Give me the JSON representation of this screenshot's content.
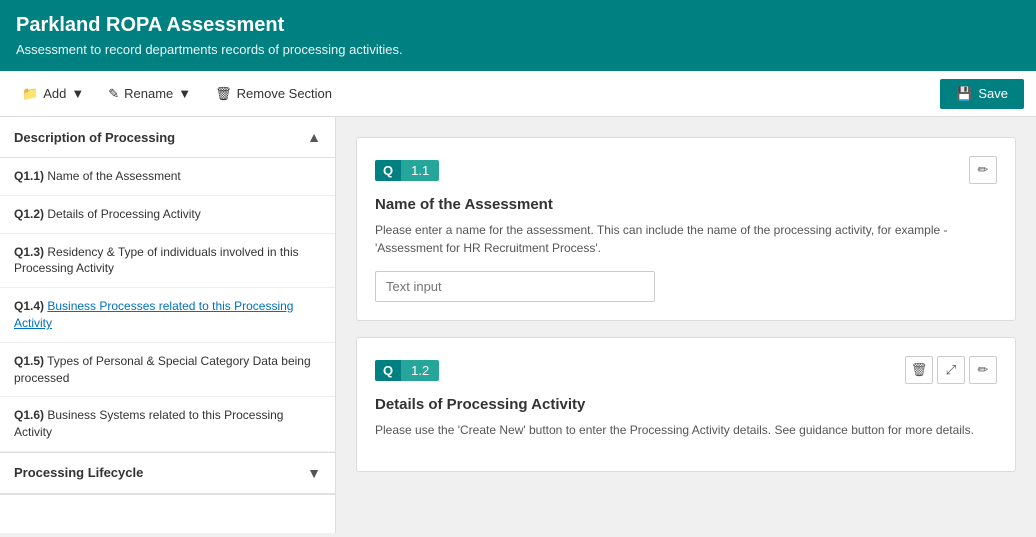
{
  "header": {
    "title": "Parkland ROPA Assessment",
    "subtitle": "Assessment to record departments records of processing activities."
  },
  "toolbar": {
    "add_label": "Add",
    "rename_label": "Rename",
    "remove_section_label": "Remove Section",
    "save_label": "Save"
  },
  "sidebar": {
    "sections": [
      {
        "id": "description",
        "title": "Description of Processing",
        "expanded": true,
        "items": [
          {
            "id": "q1_1",
            "number": "Q1.1)",
            "text": "Name of the Assessment",
            "link": false
          },
          {
            "id": "q1_2",
            "number": "Q1.2)",
            "text": "Details of Processing Activity",
            "link": false
          },
          {
            "id": "q1_3",
            "number": "Q1.3)",
            "text": "Residency & Type of individuals involved in this Processing Activity",
            "link": false
          },
          {
            "id": "q1_4",
            "number": "Q1.4)",
            "text": "Business Processes related to this Processing Activity",
            "link": true
          },
          {
            "id": "q1_5",
            "number": "Q1.5)",
            "text": "Types of Personal & Special Category Data being processed",
            "link": false
          },
          {
            "id": "q1_6",
            "number": "Q1.6)",
            "text": "Business Systems related to this Processing Activity",
            "link": false
          }
        ]
      },
      {
        "id": "lifecycle",
        "title": "Processing Lifecycle",
        "expanded": false,
        "items": []
      }
    ]
  },
  "questions": [
    {
      "id": "q1_1",
      "q_label": "Q",
      "q_number": "1.1",
      "title": "Name of the Assessment",
      "description": "Please enter a name for the assessment. This can include the name of the processing activity, for example - 'Assessment for HR Recruitment Process'.",
      "input_placeholder": "Text input",
      "input_value": "",
      "actions": [
        "edit"
      ],
      "show_input": true
    },
    {
      "id": "q1_2",
      "q_label": "Q",
      "q_number": "1.2",
      "title": "Details of Processing Activity",
      "description": "Please use the 'Create New' button to enter the Processing Activity details. See guidance button for more details.",
      "actions": [
        "delete",
        "move",
        "edit"
      ],
      "show_input": false
    }
  ],
  "icons": {
    "add": "▼",
    "rename": "▼",
    "trash": "🗑",
    "save": "💾",
    "edit": "✏",
    "move": "⤢",
    "delete": "🗑",
    "chevron_up": "▲",
    "chevron_down": "▼"
  }
}
